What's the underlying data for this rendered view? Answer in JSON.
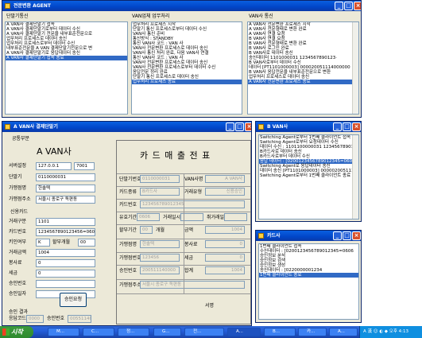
{
  "agent": {
    "title": "전문변환 AGENT",
    "cols": [
      {
        "header": "단말기통신",
        "lines": [
          "A VAN사 결제단말기 접속",
          "A VAN사 결제단말기로부터 데이터 수신",
          "A VAN사 결제단말기 전문을 내부표준전문으로",
          "업무처리 프로세스로 데이터 송신",
          "",
          "업무처리 프로세스로부터 데이터 수신",
          "내부표준전문을 A VAN 결제단말기전문으로 변",
          "A VAN사 결제단말기로 응답데이터 송신",
          "A VAN사 결제단말기 접속 종료"
        ],
        "selected": 8
      },
      {
        "header": "VAN업체 업무처리",
        "lines": [
          "업무처리 프로세스 시작",
          "단말기 통신 프로세스로부터 데이터 수신",
          "VAN사 통신 준비",
          "     통신방식 : STANDBY",
          "     통신 VAN사 코드 : VAN 사",
          "VAN사 전문변환 프로세스로 데이터 송신",
          "",
          "VAN사 통신 처리 완료, 다음 VAN사 연결",
          "     통신 VAN사 코드 : VAN 사",
          "VAN사 전문변환 프로세스로 데이터 송신",
          "",
          "VAN사 전문변환 프로세스로부터 데이터 수신",
          "응답전문 정리 완료",
          "단말기 통신 프로세스로 데이터 송신",
          "업무처리 프로세스 종료"
        ],
        "selected": 14
      },
      {
        "header": "VAN사 통신",
        "lines": [
          "A VAN사 전문변환 프로세스 시작",
          "A VAN사 전문형태로 변환 완료",
          "A VAN사 연결 요청",
          "B VAN사 연결 요청",
          "B VAN사 전문형태로 변환 완료",
          "B VAN사 로그인 완료",
          "B VAN사로 데이터 송신",
          "송신데이터    1101000031          1234567890123·",
          "",
          "B VAN사로부터 데이터 수신",
          "데이터 [PT1101000003]          000020051114000000",
          "B VAN사 응답전문을 내부표준전문으로 변환",
          "업무처리 프로세스로 데이터 송신",
          "A VAN사 전문변환 프로세스 종료"
        ],
        "selected": 13
      }
    ]
  },
  "terminal": {
    "title": "A VAN사 결제단말기",
    "group1": "공통부분",
    "brand": "A VAN사",
    "fields": [
      {
        "label": "서버설정",
        "value": "127.0.0.1",
        "extra": "7001"
      },
      {
        "label": "단말기",
        "value": "0110000031"
      },
      {
        "label": "가맹점명",
        "value": "한솔텍"
      },
      {
        "label": "가맹점주소",
        "value": "서울시 종로구 독편동"
      }
    ],
    "group2": "신용카드",
    "fields2": [
      {
        "label": "거래구분",
        "value": "1101"
      },
      {
        "label": "카드번호",
        "value": "1234567890123456=0606"
      },
      {
        "label": "키인여부",
        "value": "K",
        "extra_label": "할부개월",
        "extra": "00"
      },
      {
        "label": "거래금액",
        "value": "1004"
      },
      {
        "label": "봉사료",
        "value": "0"
      },
      {
        "label": "세금",
        "value": "0"
      },
      {
        "label": "승인번호",
        "value": ""
      },
      {
        "label": "승인일자",
        "value": ""
      }
    ],
    "approve_button": "승인요청",
    "result_label": "승인 결과",
    "result_code_label": "응답코드",
    "result_code": "0000",
    "approval_no_label": "승인번호",
    "approval_no": "00551140",
    "receipt": {
      "title": "카 드 매 출 전 표",
      "rows": [
        [
          {
            "label": "단말기번호",
            "value": "0110000031"
          },
          {
            "label": "VAN사명",
            "value": "A VAN사"
          }
        ],
        [
          {
            "label": "카드종류",
            "value": "B카드사"
          },
          {
            "label": "거래유형",
            "value": "신용승인"
          }
        ],
        [
          {
            "label": "카드번호",
            "value": "123456789012345"
          }
        ],
        [
          {
            "label": "유효기간",
            "value": "0606"
          },
          {
            "label": "거래일시",
            "value": ""
          },
          {
            "label": "취거래일",
            "value": ""
          }
        ],
        [
          {
            "label": "할부기간",
            "value": "00",
            "unit": "개월"
          },
          {
            "label": "금액",
            "value": "1004"
          }
        ],
        [
          {
            "label": "가맹점명",
            "value": "한솔텍"
          },
          {
            "label": "봉사료",
            "value": "0"
          }
        ],
        [
          {
            "label": "가맹점번호",
            "value": "123456"
          },
          {
            "label": "세금",
            "value": "0"
          }
        ],
        [
          {
            "label": "승인번호",
            "value": "200511140000"
          },
          {
            "label": "합계",
            "value": "1004"
          }
        ],
        [
          {
            "label": "가맹점주소",
            "value": "서울시 종로구 독편동"
          }
        ],
        [
          {
            "label": "서명",
            "value": ""
          }
        ]
      ]
    }
  },
  "bvan": {
    "title": "B VAN사",
    "lines": [
      "Switching Agent로부터 1번째 클라이언트 접속",
      "Switching Agent로부터 요청데이터 수신",
      "데이터 수신 : 1101100000031          12345678901234567",
      "B카드사로 데이터 송신",
      "B카드사로부터 데이터 수신",
      "응답 데이터 : [0200123456789012345=0606",
      "Switching Agent로 응답데이터 송신",
      "데이터 송신 [PT1101000003]          00000200511140000",
      "Switching Agent로부터 1번째 클라이언트 종료"
    ],
    "selected": 5
  },
  "cardco": {
    "title": "카드사",
    "lines": [
      "1번째 클라이언트 접속",
      "수신데이터 : [0200123456789012345=0606",
      "승인정보 분석",
      "승인정보 검색",
      "승인정보 생성",
      "송신데이터 : [0220000001234",
      "1번째 클라이언트 종료"
    ],
    "selected": 6
  },
  "taskbar": {
    "start": "시작",
    "items": [
      "M...",
      "C...",
      "정...",
      "G...",
      "전...",
      "A...",
      "B...",
      "카...",
      "A..."
    ],
    "active": 5,
    "ime": "A 漢",
    "clock": "오후 4:13"
  }
}
